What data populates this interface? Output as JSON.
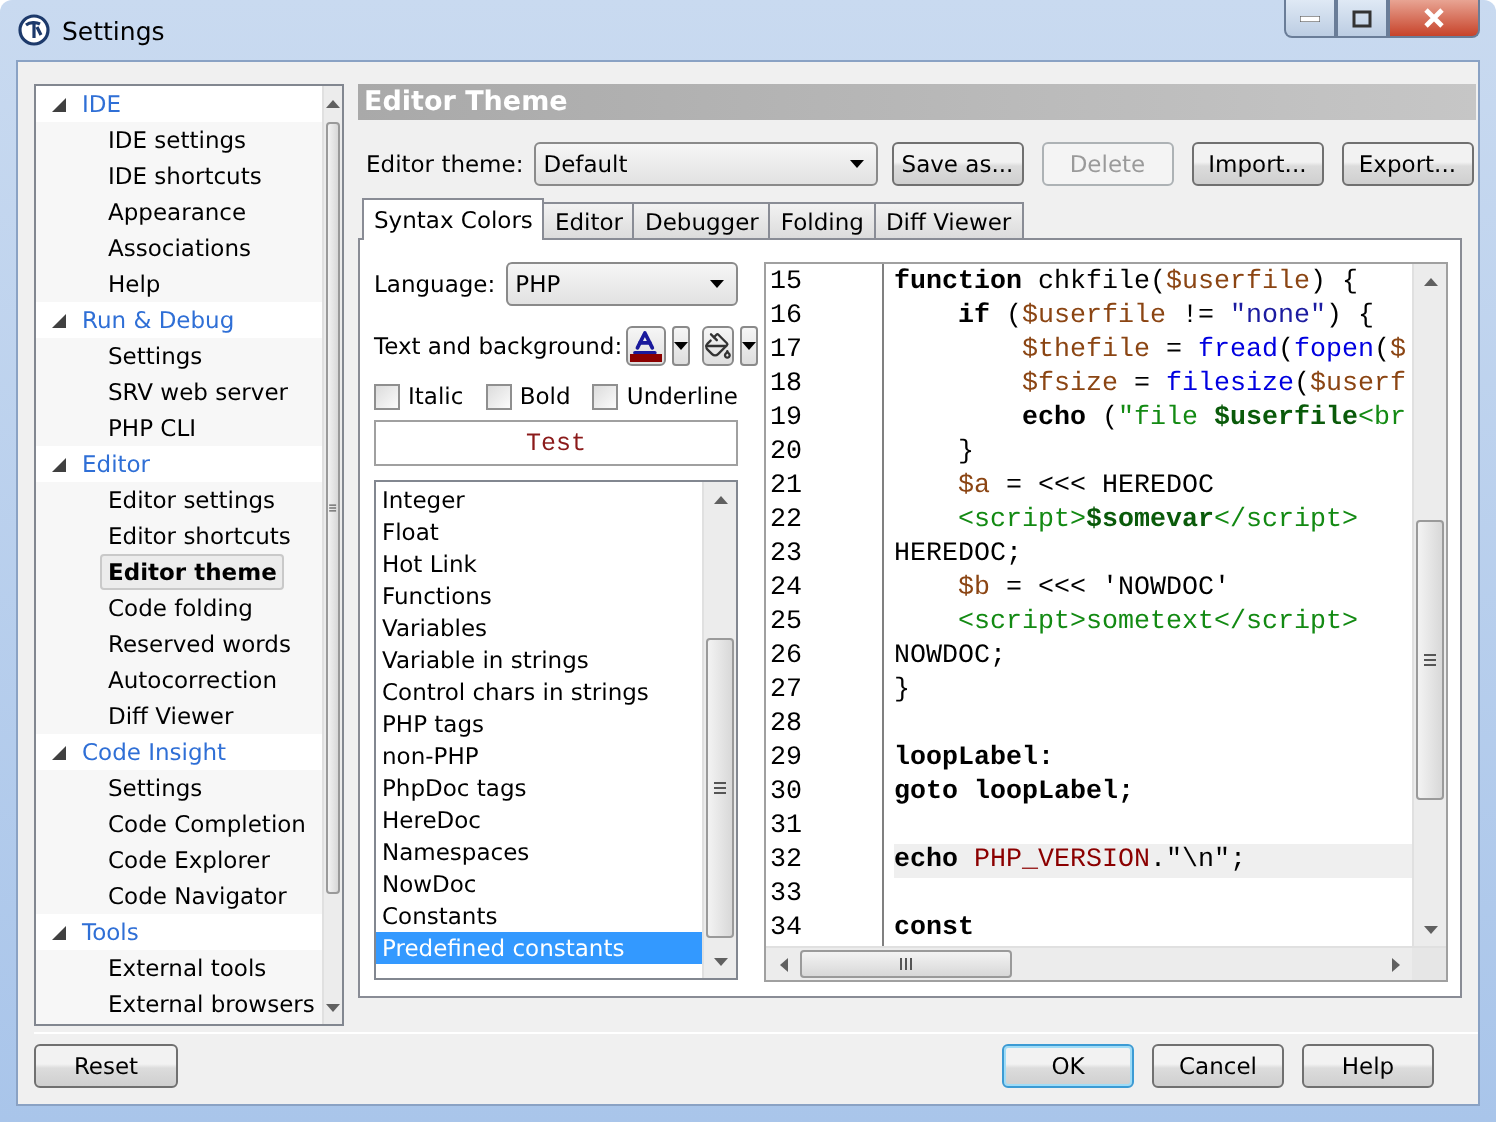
{
  "window": {
    "title": "Settings"
  },
  "sidebar": {
    "groups": [
      {
        "label": "IDE",
        "expanded": true,
        "children": [
          {
            "label": "IDE settings",
            "selected": false
          },
          {
            "label": "IDE shortcuts",
            "selected": false
          },
          {
            "label": "Appearance",
            "selected": false
          },
          {
            "label": "Associations",
            "selected": false
          },
          {
            "label": "Help",
            "selected": false
          }
        ]
      },
      {
        "label": "Run & Debug",
        "expanded": true,
        "children": [
          {
            "label": "Settings",
            "selected": false
          },
          {
            "label": "SRV web server",
            "selected": false
          },
          {
            "label": "PHP CLI",
            "selected": false
          }
        ]
      },
      {
        "label": "Editor",
        "expanded": true,
        "children": [
          {
            "label": "Editor settings",
            "selected": false
          },
          {
            "label": "Editor shortcuts",
            "selected": false
          },
          {
            "label": "Editor theme",
            "selected": true
          },
          {
            "label": "Code folding",
            "selected": false
          },
          {
            "label": "Reserved words",
            "selected": false
          },
          {
            "label": "Autocorrection",
            "selected": false
          },
          {
            "label": "Diff Viewer",
            "selected": false
          }
        ]
      },
      {
        "label": "Code Insight",
        "expanded": true,
        "children": [
          {
            "label": "Settings",
            "selected": false
          },
          {
            "label": "Code Completion",
            "selected": false
          },
          {
            "label": "Code Explorer",
            "selected": false
          },
          {
            "label": "Code Navigator",
            "selected": false
          }
        ]
      },
      {
        "label": "Tools",
        "expanded": true,
        "children": [
          {
            "label": "External tools",
            "selected": false
          },
          {
            "label": "External browsers",
            "selected": false
          }
        ]
      }
    ]
  },
  "panel": {
    "title": "Editor Theme",
    "theme": {
      "label": "Editor theme:",
      "value": "Default"
    },
    "theme_buttons": [
      {
        "label": "Save as...",
        "disabled": false
      },
      {
        "label": "Delete",
        "disabled": true
      },
      {
        "label": "Import...",
        "disabled": false
      },
      {
        "label": "Export...",
        "disabled": false
      }
    ],
    "tabs": [
      {
        "label": "Syntax Colors",
        "selected": true
      },
      {
        "label": "Editor",
        "selected": false
      },
      {
        "label": "Debugger",
        "selected": false
      },
      {
        "label": "Folding",
        "selected": false
      },
      {
        "label": "Diff Viewer",
        "selected": false
      }
    ],
    "language": {
      "label": "Language:",
      "value": "PHP"
    },
    "text_and_background": {
      "label": "Text and background:"
    },
    "styles": [
      {
        "label": "Italic",
        "checked": false
      },
      {
        "label": "Bold",
        "checked": false
      },
      {
        "label": "Underline",
        "checked": false
      }
    ],
    "preview": {
      "text": "Test"
    },
    "elements": [
      {
        "label": "Integer",
        "selected": false
      },
      {
        "label": "Float",
        "selected": false
      },
      {
        "label": "Hot Link",
        "selected": false
      },
      {
        "label": "Functions",
        "selected": false
      },
      {
        "label": "Variables",
        "selected": false
      },
      {
        "label": "Variable in strings",
        "selected": false
      },
      {
        "label": "Control chars in strings",
        "selected": false
      },
      {
        "label": "PHP tags",
        "selected": false
      },
      {
        "label": "non-PHP",
        "selected": false
      },
      {
        "label": "PhpDoc tags",
        "selected": false
      },
      {
        "label": "HereDoc",
        "selected": false
      },
      {
        "label": "Namespaces",
        "selected": false
      },
      {
        "label": "NowDoc",
        "selected": false
      },
      {
        "label": "Constants",
        "selected": false
      },
      {
        "label": "Predefined constants",
        "selected": true
      }
    ],
    "code": [
      {
        "num": "15",
        "highlighted": false,
        "tokens": [
          {
            "kind": "keyword",
            "text": "function "
          },
          {
            "kind": "plain",
            "text": "chkfile("
          },
          {
            "kind": "variable",
            "text": "$userfile"
          },
          {
            "kind": "plain",
            "text": ") {"
          }
        ]
      },
      {
        "num": "16",
        "highlighted": false,
        "tokens": [
          {
            "kind": "keyword",
            "text": "    if "
          },
          {
            "kind": "plain",
            "text": "("
          },
          {
            "kind": "variable",
            "text": "$userfile"
          },
          {
            "kind": "plain",
            "text": " != "
          },
          {
            "kind": "string",
            "text": "\"none\""
          },
          {
            "kind": "plain",
            "text": ") {"
          }
        ]
      },
      {
        "num": "17",
        "highlighted": false,
        "tokens": [
          {
            "kind": "variable",
            "text": "        $thefile"
          },
          {
            "kind": "plain",
            "text": " = "
          },
          {
            "kind": "function",
            "text": "fread"
          },
          {
            "kind": "plain",
            "text": "("
          },
          {
            "kind": "function",
            "text": "fopen"
          },
          {
            "kind": "plain",
            "text": "("
          },
          {
            "kind": "variable",
            "text": "$"
          }
        ]
      },
      {
        "num": "18",
        "highlighted": false,
        "tokens": [
          {
            "kind": "variable",
            "text": "        $fsize"
          },
          {
            "kind": "plain",
            "text": " = "
          },
          {
            "kind": "function",
            "text": "filesize"
          },
          {
            "kind": "plain",
            "text": "("
          },
          {
            "kind": "variable",
            "text": "$userf"
          }
        ]
      },
      {
        "num": "19",
        "highlighted": false,
        "tokens": [
          {
            "kind": "keyword",
            "text": "        echo "
          },
          {
            "kind": "plain",
            "text": "("
          },
          {
            "kind": "heredoc",
            "text": "\"file "
          },
          {
            "kind": "var_in_string",
            "text": "$userfile"
          },
          {
            "kind": "heredoc",
            "text": "<br"
          }
        ]
      },
      {
        "num": "20",
        "highlighted": false,
        "tokens": [
          {
            "kind": "plain",
            "text": "    }"
          }
        ]
      },
      {
        "num": "21",
        "highlighted": false,
        "tokens": [
          {
            "kind": "variable",
            "text": "    $a"
          },
          {
            "kind": "plain",
            "text": " = <<< HEREDOC"
          }
        ]
      },
      {
        "num": "22",
        "highlighted": false,
        "tokens": [
          {
            "kind": "heredoc",
            "text": "    <script>"
          },
          {
            "kind": "var_in_string",
            "text": "$somevar"
          },
          {
            "kind": "heredoc",
            "text": "</script>"
          }
        ]
      },
      {
        "num": "23",
        "highlighted": false,
        "tokens": [
          {
            "kind": "plain",
            "text": "HEREDOC;"
          }
        ]
      },
      {
        "num": "24",
        "highlighted": false,
        "tokens": [
          {
            "kind": "variable",
            "text": "    $b"
          },
          {
            "kind": "plain",
            "text": " = <<< 'NOWDOC'"
          }
        ]
      },
      {
        "num": "25",
        "highlighted": false,
        "tokens": [
          {
            "kind": "heredoc",
            "text": "    <script>sometext</script>"
          }
        ]
      },
      {
        "num": "26",
        "highlighted": false,
        "tokens": [
          {
            "kind": "plain",
            "text": "NOWDOC;"
          }
        ]
      },
      {
        "num": "27",
        "highlighted": false,
        "tokens": [
          {
            "kind": "plain",
            "text": "}"
          }
        ]
      },
      {
        "num": "28",
        "highlighted": false
      },
      {
        "num": "29",
        "highlighted": false,
        "tokens": [
          {
            "kind": "keyword",
            "text": "loopLabel:"
          }
        ]
      },
      {
        "num": "30",
        "highlighted": false,
        "tokens": [
          {
            "kind": "keyword",
            "text": "goto "
          },
          {
            "kind": "keyword",
            "text": "loopLabel;"
          }
        ]
      },
      {
        "num": "31",
        "highlighted": false
      },
      {
        "num": "32",
        "highlighted": true,
        "tokens": [
          {
            "kind": "keyword",
            "text": "echo "
          },
          {
            "kind": "constant",
            "text": "PHP_VERSION"
          },
          {
            "kind": "plain",
            "text": "."
          },
          {
            "kind": "plain",
            "text": "\"\\n\";"
          }
        ]
      },
      {
        "num": "33",
        "highlighted": false
      },
      {
        "num": "34",
        "highlighted": false,
        "tokens": [
          {
            "kind": "keyword",
            "text": "const"
          }
        ]
      }
    ]
  },
  "footer_buttons": [
    {
      "label": "Reset",
      "default": false
    },
    {
      "label": "OK",
      "default": true
    },
    {
      "label": "Cancel",
      "default": false
    },
    {
      "label": "Help",
      "default": false
    }
  ]
}
